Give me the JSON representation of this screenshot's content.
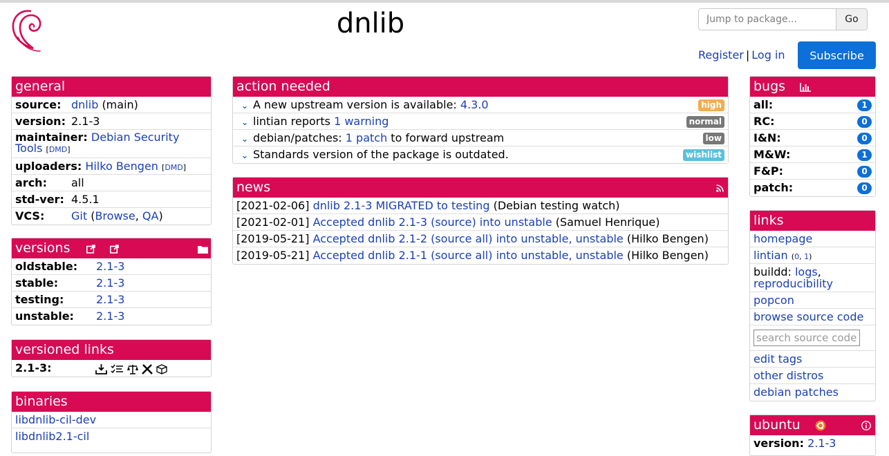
{
  "header": {
    "title": "dnlib",
    "search_placeholder": "Jump to package...",
    "go_label": "Go",
    "register_label": "Register",
    "separator": "|",
    "login_label": "Log in",
    "subscribe_label": "Subscribe"
  },
  "general": {
    "title": "general",
    "source_key": "source:",
    "source_link": "dnlib",
    "source_extra": "(main)",
    "version_key": "version:",
    "version_val": "2.1-3",
    "maintainer_key": "maintainer:",
    "maintainer_link": "Debian Security Tools",
    "maintainer_dmd": "DMD",
    "uploaders_key": "uploaders:",
    "uploaders_link": "Hilko Bengen",
    "uploaders_dmd": "DMD",
    "arch_key": "arch:",
    "arch_val": "all",
    "stdver_key": "std-ver:",
    "stdver_val": "4.5.1",
    "vcs_key": "VCS:",
    "vcs_git": "Git",
    "vcs_browse": "Browse",
    "vcs_qa": "QA"
  },
  "versions": {
    "title": "versions",
    "rows": [
      {
        "key": "oldstable:",
        "val": "2.1-3"
      },
      {
        "key": "stable:",
        "val": "2.1-3"
      },
      {
        "key": "testing:",
        "val": "2.1-3"
      },
      {
        "key": "unstable:",
        "val": "2.1-3"
      }
    ]
  },
  "versioned_links": {
    "title": "versioned links",
    "key": "2.1-3:"
  },
  "binaries": {
    "title": "binaries",
    "items": [
      "libdnlib-cil-dev",
      "libdnlib2.1-cil"
    ]
  },
  "action_needed": {
    "title": "action needed",
    "items": [
      {
        "pre": "A new upstream version is available: ",
        "link": "4.3.0",
        "post": "",
        "badge": "high",
        "color": "#f0ad4e"
      },
      {
        "pre": "lintian reports ",
        "link": "1 warning",
        "post": "",
        "badge": "normal",
        "color": "#777777"
      },
      {
        "pre": "debian/patches: ",
        "link": "1 patch",
        "post": " to forward upstream",
        "badge": "low",
        "color": "#777777"
      },
      {
        "pre": "Standards version of the package is outdated.",
        "link": "",
        "post": "",
        "badge": "wishlist",
        "color": "#5bc0de"
      }
    ]
  },
  "news": {
    "title": "news",
    "items": [
      {
        "date": "[2021-02-06]",
        "link": "dnlib 2.1-3 MIGRATED to testing",
        "who": "(Debian testing watch)"
      },
      {
        "date": "[2021-02-01]",
        "link": "Accepted dnlib 2.1-3 (source) into unstable",
        "who": "(Samuel Henrique)"
      },
      {
        "date": "[2019-05-21]",
        "link": "Accepted dnlib 2.1-2 (source all) into unstable, unstable",
        "who": "(Hilko Bengen)"
      },
      {
        "date": "[2019-05-21]",
        "link": "Accepted dnlib 2.1-1 (source all) into unstable, unstable",
        "who": "(Hilko Bengen)"
      }
    ]
  },
  "bugs": {
    "title": "bugs",
    "rows": [
      {
        "key": "all:",
        "count": "1"
      },
      {
        "key": "RC:",
        "count": "0"
      },
      {
        "key": "I&N:",
        "count": "0"
      },
      {
        "key": "M&W:",
        "count": "1"
      },
      {
        "key": "F&P:",
        "count": "0"
      },
      {
        "key": "patch:",
        "count": "0"
      }
    ]
  },
  "links": {
    "title": "links",
    "homepage": "homepage",
    "lintian": "lintian",
    "lintian_counts_open": "(",
    "lintian_c0": "0",
    "lintian_comma": ", ",
    "lintian_c1": "1",
    "lintian_counts_close": ")",
    "buildd_label": "buildd:",
    "buildd_logs": "logs",
    "buildd_repro": "reproducibility",
    "popcon": "popcon",
    "browse_source": "browse source code",
    "search_placeholder": "search source code",
    "edit_tags": "edit tags",
    "other_distros": "other distros",
    "debian_patches": "debian patches"
  },
  "ubuntu": {
    "title": "ubuntu",
    "version_key": "version:",
    "version_val": "2.1-3"
  },
  "colors": {
    "panel_header": "#d70a53",
    "link": "#1a3fb8",
    "subscribe": "#0d6fd8"
  }
}
